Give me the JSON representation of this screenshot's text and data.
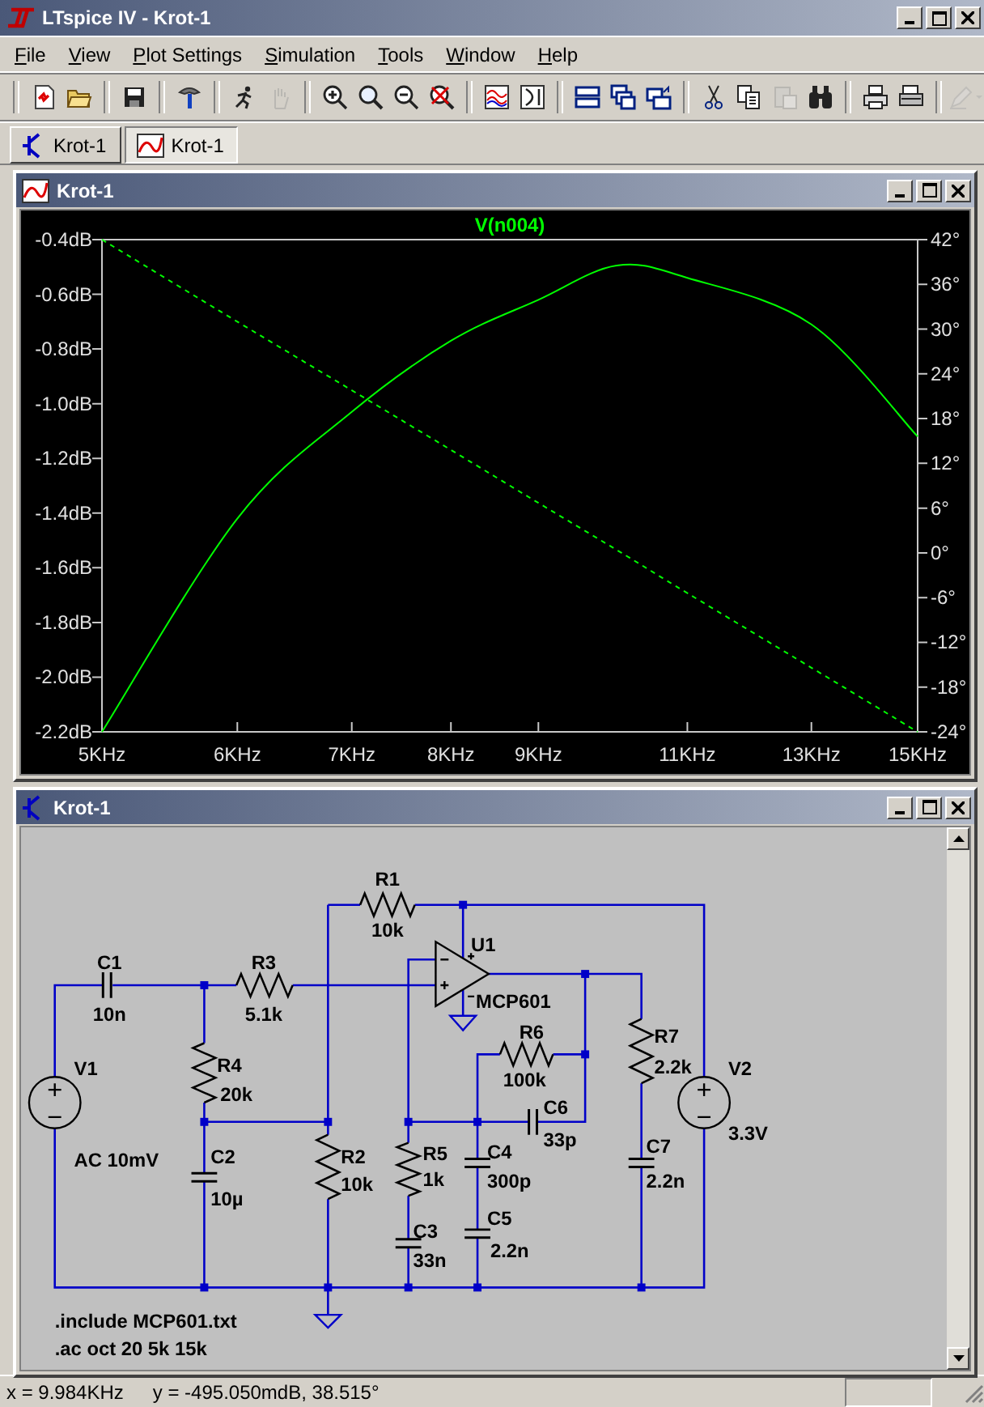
{
  "window": {
    "title": "LTspice IV - Krot-1"
  },
  "menu": [
    {
      "label": "File"
    },
    {
      "label": "View"
    },
    {
      "label": "Plot Settings"
    },
    {
      "label": "Simulation"
    },
    {
      "label": "Tools"
    },
    {
      "label": "Window"
    },
    {
      "label": "Help"
    }
  ],
  "toolbar_groups": [
    [
      {
        "disabled": false
      },
      {
        "disabled": false
      }
    ],
    [
      {
        "disabled": false
      }
    ],
    [
      {
        "disabled": false
      }
    ],
    [
      {
        "disabled": false
      },
      {
        "disabled": true
      }
    ],
    [
      {
        "disabled": false
      },
      {
        "disabled": false
      },
      {
        "disabled": false
      },
      {
        "disabled": false
      }
    ],
    [
      {
        "disabled": false
      },
      {
        "disabled": false
      }
    ],
    [
      {
        "disabled": false
      },
      {
        "disabled": false
      },
      {
        "disabled": false
      }
    ],
    [
      {
        "disabled": false
      },
      {
        "disabled": false
      },
      {
        "disabled": true
      },
      {
        "disabled": false
      }
    ],
    [
      {
        "disabled": false
      },
      {
        "disabled": false
      }
    ],
    [
      {
        "disabled": true
      }
    ]
  ],
  "tabs": [
    {
      "label": "Krot-1",
      "kind": "schematic",
      "selected": false
    },
    {
      "label": "Krot-1",
      "kind": "plot",
      "selected": true
    }
  ],
  "plot_window": {
    "title": "Krot-1",
    "chart_data": {
      "type": "line",
      "categories": [
        "5KHz",
        "6KHz",
        "7KHz",
        "8KHz",
        "9KHz",
        null,
        "11KHz",
        "13KHz",
        "15KHz"
      ],
      "ylim": [
        -2.2,
        -0.4
      ],
      "y2lim": [
        -24,
        42
      ],
      "y2ticks": [
        {
          "value": 42,
          "label": "42°"
        },
        {
          "value": 36,
          "label": "36°"
        },
        {
          "value": 30,
          "label": "30°"
        },
        {
          "value": 24,
          "label": "24°"
        },
        {
          "value": 18,
          "label": "18°"
        },
        {
          "value": 12,
          "label": "12°"
        },
        {
          "value": 6,
          "label": "6°"
        },
        {
          "value": 0,
          "label": "0°"
        },
        {
          "value": -6,
          "label": "-6°"
        },
        {
          "value": -12,
          "label": "-12°"
        },
        {
          "value": -18,
          "label": "-18°"
        },
        {
          "value": -24,
          "label": "-24°"
        }
      ],
      "yticks": [
        {
          "value": -0.4,
          "label": "-0.4dB"
        },
        {
          "value": -0.6,
          "label": "-0.6dB"
        },
        {
          "value": -0.8,
          "label": "-0.8dB"
        },
        {
          "value": -1.0,
          "label": "-1.0dB"
        },
        {
          "value": -1.2,
          "label": "-1.2dB"
        },
        {
          "value": -1.4,
          "label": "-1.4dB"
        },
        {
          "value": -1.6,
          "label": "-1.6dB"
        },
        {
          "value": -1.8,
          "label": "-1.8dB"
        },
        {
          "value": -2.0,
          "label": "-2.0dB"
        },
        {
          "value": -2.2,
          "label": "-2.2dB"
        }
      ],
      "series": [
        {
          "name": "V(n004)",
          "color": "#00ff00",
          "values": [
            -2.2,
            -1.42,
            -1.03,
            -0.77,
            -0.62,
            -0.495,
            -0.54,
            -0.71,
            -1.12
          ]
        },
        {
          "color": "#00ff00",
          "axis": "y2",
          "line_style": "dashed",
          "values": [
            42,
            31,
            21.8,
            13.8,
            6.7,
            0.4,
            -5.4,
            -15.4,
            -24
          ]
        }
      ]
    }
  },
  "schematic_window": {
    "title": "Krot-1",
    "components": [
      {
        "kind": "resistor",
        "ref": "R1",
        "value": "10k"
      },
      {
        "kind": "opamp",
        "ref": "U1",
        "value": "MCP601"
      },
      {
        "kind": "capacitor",
        "ref": "C1",
        "value": "10n"
      },
      {
        "kind": "resistor",
        "ref": "R3",
        "value": "5.1k"
      },
      {
        "kind": "source",
        "ref": "V1",
        "value": "AC 10mV"
      },
      {
        "kind": "resistor",
        "ref": "R4",
        "value": "20k"
      },
      {
        "kind": "resistor",
        "ref": "R6",
        "value": "100k"
      },
      {
        "kind": "capacitor",
        "ref": "C6",
        "value": "33p"
      },
      {
        "kind": "resistor",
        "ref": "R7",
        "value": "2.2k"
      },
      {
        "kind": "source",
        "ref": "V2",
        "value": "3.3V"
      },
      {
        "kind": "capacitor",
        "ref": "C2",
        "value": "10µ"
      },
      {
        "kind": "resistor",
        "ref": "R2",
        "value": "10k"
      },
      {
        "kind": "resistor",
        "ref": "R5",
        "value": "1k"
      },
      {
        "kind": "capacitor",
        "ref": "C4",
        "value": "300p"
      },
      {
        "kind": "capacitor",
        "ref": "C5",
        "value": "2.2n"
      },
      {
        "kind": "capacitor",
        "ref": "C3",
        "value": "33n"
      },
      {
        "kind": "capacitor",
        "ref": "C7",
        "value": "2.2n"
      }
    ],
    "directives": [
      ".include MCP601.txt",
      ".ac oct 20 5k 15k"
    ]
  },
  "status_bar": {
    "x_reading": "x = 9.984KHz",
    "y_reading": "y = -495.050mdB, 38.515°"
  }
}
